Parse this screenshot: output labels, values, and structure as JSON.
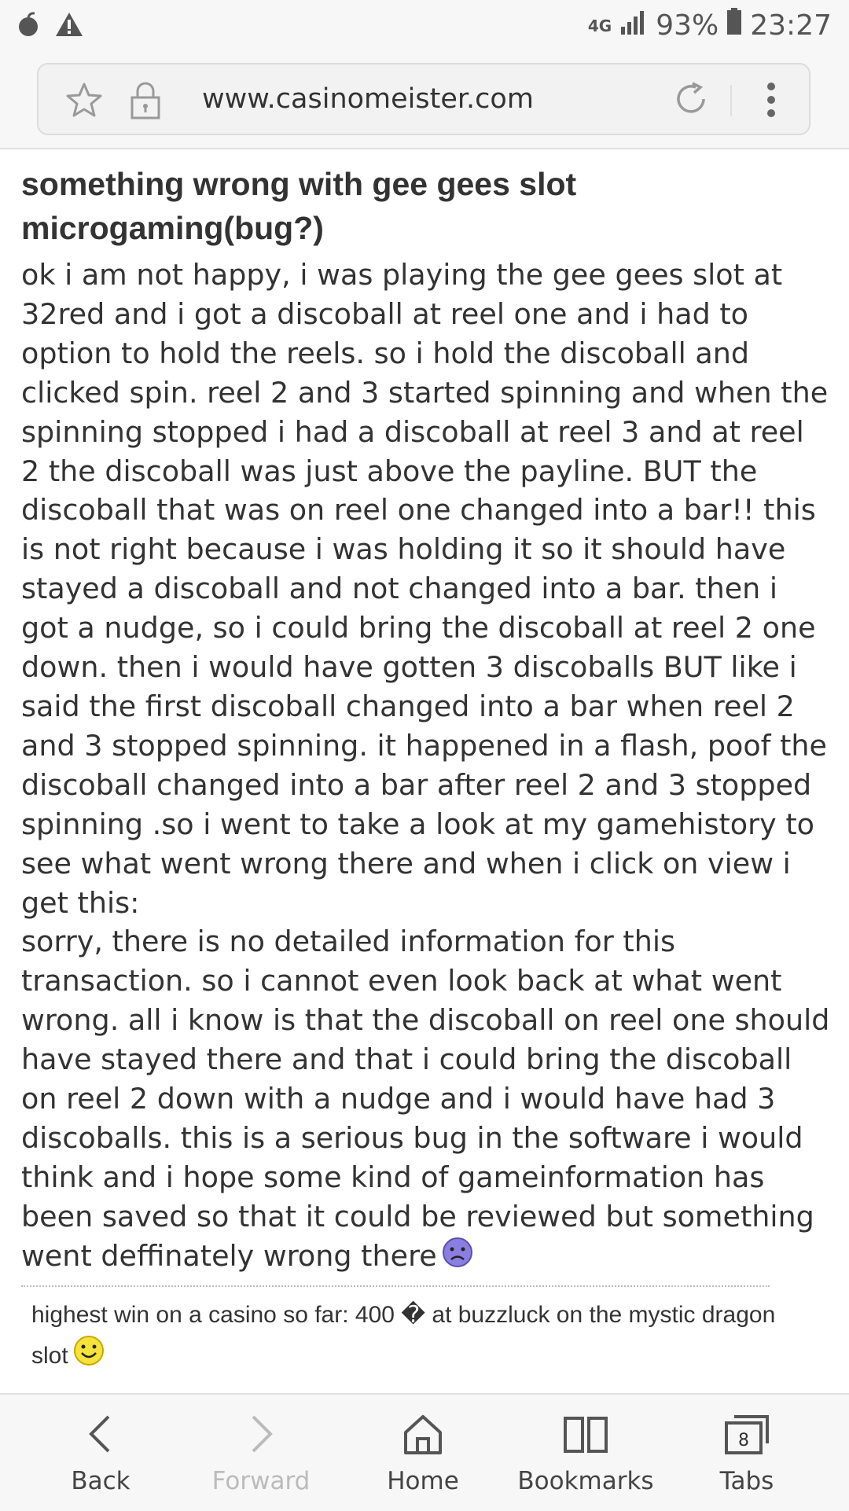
{
  "status_bar": {
    "network": "4G",
    "battery": "93%",
    "time": "23:27"
  },
  "browser": {
    "url": "www.casinomeister.com"
  },
  "post": {
    "title": "something wrong with gee gees slot microgaming(bug?)",
    "body_1": "ok i am not happy, i was playing the gee gees slot at 32red and i got a discoball at reel one and i had to option to hold the reels. so i hold the discoball and clicked spin. reel 2 and 3 started spinning and when the spinning stopped i had a discoball at reel 3 and at reel 2 the discoball was just above the payline. BUT the discoball that was on reel one changed into a bar!! this is not right because i was holding it so it should have stayed a discoball and not changed into a bar. then i got a nudge, so i could bring the discoball at reel 2 one down. then i would have gotten 3 discoballs BUT like i said the first discoball changed into a bar when reel 2 and 3 stopped spinning. it happened in a flash, poof the discoball changed into a bar after reel 2 and 3 stopped spinning .so i went to take a look at my gamehistory to see what went wrong there and when i click on view i get this:",
    "body_2": "sorry, there is no detailed information for this transaction. so i cannot even look back at what went wrong. all i know is that the discoball on reel one should have stayed there and that i could bring the discoball on reel 2 down with a nudge and i would have had 3 discoballs. this is a serious bug in the software i would think and i hope some kind of gameinformation has been saved so that it could be reviewed but something went deffinately wrong there",
    "body_emoji": "frown-emoji",
    "signature": "highest win on a casino so far: 400 � at buzzluck on the mystic dragon slot",
    "signature_emoji": "smile-emoji"
  },
  "bottom_nav": {
    "back": "Back",
    "forward": "Forward",
    "home": "Home",
    "bookmarks": "Bookmarks",
    "tabs": "Tabs",
    "tabs_count": "8"
  },
  "colors": {
    "chrome_bg": "#f7f7f7",
    "text": "#333333",
    "disabled": "#bbbbbb"
  }
}
